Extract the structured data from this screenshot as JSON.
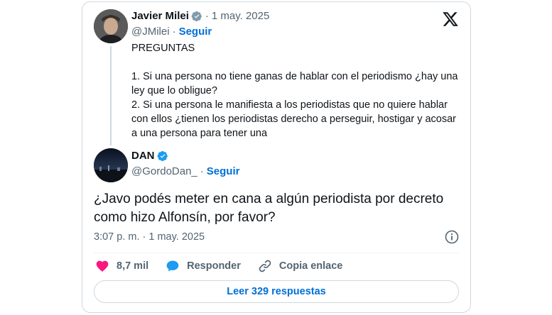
{
  "quoted": {
    "name": "Javier Milei",
    "date": "1 may. 2025",
    "handle": "@JMilei",
    "follow": "Seguir",
    "lines": [
      "PREGUNTAS",
      "",
      "1. Si una persona no tiene ganas de hablar con el periodismo ¿hay una ley que lo obligue?",
      "2. Si una persona le manifiesta a los periodistas que no quiere hablar con ellos ¿tienen los periodistas derecho a perseguir, hostigar y acosar a una persona para tener una"
    ]
  },
  "reply": {
    "name": "DAN",
    "handle": "@GordoDan_",
    "follow": "Seguir",
    "text": "¿Javo podés meter en cana a algún periodista por decreto como hizo Alfonsín, por favor?",
    "timestamp": "3:07 p. m. · 1 may. 2025"
  },
  "actions": {
    "likes": "8,7 mil",
    "reply": "Responder",
    "copy": "Copia enlace"
  },
  "replies_button": "Leer 329 respuestas",
  "icons": {
    "logo": "x-logo-icon",
    "verified": "verified-badge-icon",
    "info": "info-icon",
    "like": "heart-icon",
    "reply": "speech-bubble-icon",
    "copy": "link-icon"
  },
  "colors": {
    "verified_badge": "#829aab",
    "verified_blue": "#1d9bf0",
    "link": "#006fd6",
    "heart": "#f91880",
    "muted": "#536471",
    "border": "#cfd9de"
  }
}
